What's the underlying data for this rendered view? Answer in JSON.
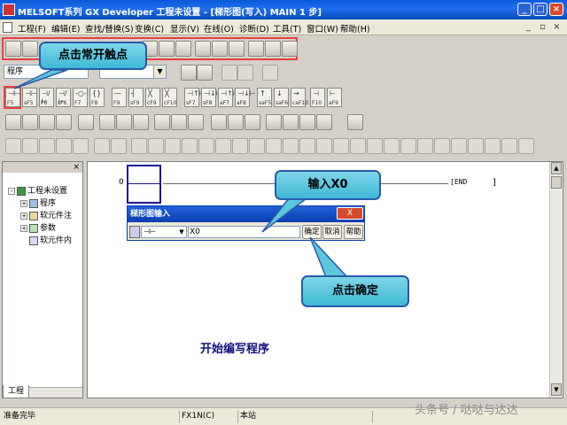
{
  "window": {
    "title": "MELSOFT系列 GX Developer 工程未设置 - [梯形图(写入)    MAIN    1 步]",
    "minimize": "_",
    "maximize": "□",
    "close": "×"
  },
  "menu": {
    "items": [
      "工程(F)",
      "编辑(E)",
      "查找/替换(S)",
      "变换(C)",
      "显示(V)",
      "在线(O)",
      "诊断(D)",
      "工具(T)",
      "窗口(W)",
      "帮助(H)"
    ],
    "mdi_min": "_",
    "mdi_restore": "▫",
    "mdi_close": "×"
  },
  "toolbar": {
    "program_select": "程序"
  },
  "function_keys": [
    {
      "sym": "⊣⊢",
      "label": "F5"
    },
    {
      "sym": "⊣⊢",
      "label": "sF5"
    },
    {
      "sym": "⊣/⊢",
      "label": "F6"
    },
    {
      "sym": "⊣/⊢",
      "label": "sF6"
    },
    {
      "sym": "-○-",
      "label": "F7"
    },
    {
      "sym": "{}",
      "label": "F8"
    },
    {
      "sym": "—",
      "label": "F9"
    },
    {
      "sym": "┤",
      "label": "sF9"
    },
    {
      "sym": "╳",
      "label": "cF9"
    },
    {
      "sym": "╳",
      "label": "cF10"
    },
    {
      "sym": "⊣↑⊢",
      "label": "sF7"
    },
    {
      "sym": "⊣↓⊢",
      "label": "sF8"
    },
    {
      "sym": "⊣↑⊢",
      "label": "aF7"
    },
    {
      "sym": "⊣↓⊢",
      "label": "aF8"
    },
    {
      "sym": "↑",
      "label": "saF5"
    },
    {
      "sym": "↓",
      "label": "saF6"
    },
    {
      "sym": "→",
      "label": "caF10"
    },
    {
      "sym": "⊣",
      "label": "F10"
    },
    {
      "sym": "⊢",
      "label": "aF9"
    }
  ],
  "project_panel": {
    "close": "×",
    "root": "工程未设置",
    "items": [
      "程序",
      "软元件注",
      "参数",
      "软元件内"
    ],
    "tab": "工程"
  },
  "editor": {
    "rung_number": "0",
    "end_label": "[END",
    "right_rail": "]"
  },
  "dialog": {
    "title": "梯形图输入",
    "close": "X",
    "type_value": "⊣⊢",
    "dropdown": "▼",
    "input_value": "X0",
    "ok": "确定",
    "cancel": "取消",
    "help": "帮助"
  },
  "callouts": {
    "click_contact": "点击常开触点",
    "input_x0": "输入X0",
    "click_ok": "点击确定",
    "start_programming": "开始编写程序"
  },
  "status_bar": {
    "ready": "准备完毕",
    "cpu": "FX1N(C)",
    "station": "本站"
  },
  "watermark": "头条号 / 哒哒与达达"
}
